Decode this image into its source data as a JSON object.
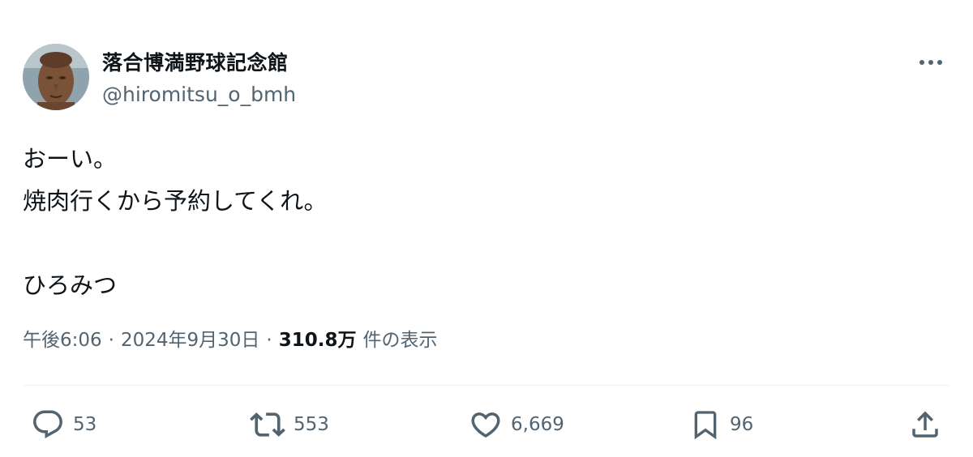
{
  "tweet": {
    "display_name": "落合博満野球記念館",
    "handle": "@hiromitsu_o_bmh",
    "text_lines": [
      "おーい。",
      "焼肉行くから予約してくれ。",
      "",
      "ひろみつ"
    ],
    "time": "午後6:06",
    "separator": "·",
    "date": "2024年9月30日",
    "views_count": "310.8万",
    "views_label": "件の表示"
  },
  "actions": {
    "reply_count": "53",
    "retweet_count": "553",
    "like_count": "6,669",
    "bookmark_count": "96"
  },
  "icons": {
    "more": "more-horizontal-icon",
    "reply": "reply-icon",
    "retweet": "retweet-icon",
    "like": "heart-icon",
    "bookmark": "bookmark-icon",
    "share": "share-icon"
  },
  "colors": {
    "text": "#0f1419",
    "secondary": "#536471",
    "divider": "#eff3f4"
  }
}
